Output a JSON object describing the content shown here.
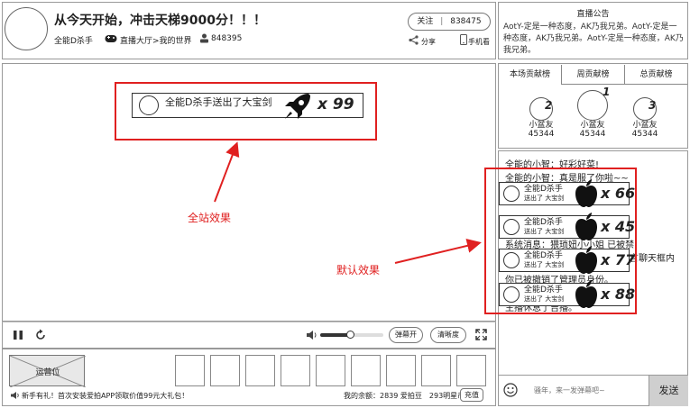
{
  "header": {
    "title": "从今天开始，冲击天梯9000分！！！",
    "streamer": "全能D杀手",
    "breadcrumb": "直播大厅>我的世界",
    "viewer_count": "848395",
    "follow_label": "关注",
    "follow_count": "838475",
    "share_label": "分享",
    "mobile_label": "手机看"
  },
  "announcement": {
    "title": "直播公告",
    "text": "AotY-定是一种态度，AK乃我兄弟。AotY-定是一种态度，AK乃我兄弟。AotY-定是一种态度，AK乃我兄弟。"
  },
  "player": {
    "site_effect": {
      "name": "全能D杀手送出了大宝剑",
      "count": "x 99"
    },
    "site_effect_label": "全站效果",
    "default_effect_label": "默认效果",
    "danmu_on_label": "弹幕开",
    "quality_label": "清晰度"
  },
  "bottom": {
    "ad_label": "运营位",
    "promo_text": "新手有礼！首次安装爱拍APP领取价值99元大礼包！",
    "balance_text": "我的余额：2839 爱拍豆　293明星币",
    "recharge_label": "充值"
  },
  "ranking": {
    "tabs": [
      "本场贡献榜",
      "周贡献榜",
      "总贡献榜"
    ],
    "items": [
      {
        "rank": "2",
        "name": "小盆友",
        "score": "45344"
      },
      {
        "rank": "1",
        "name": "小盆友",
        "score": "45344"
      },
      {
        "rank": "3",
        "name": "小盆友",
        "score": "45344"
      }
    ]
  },
  "chat": {
    "lines": [
      "全能的小智：好彩好菜!",
      "全能的小智：真是服了你啦~~",
      "系统消息：猥琐妞小小姐 已被禁",
      "言聊天框内",
      "你已被撤销了管理员身份。",
      "主播休息了吉播。"
    ],
    "gifts": [
      {
        "name": "全能D杀手",
        "action": "送出了 大宝剑",
        "count": "x 66"
      },
      {
        "name": "全能D杀手",
        "action": "送出了 大宝剑",
        "count": "x 45"
      },
      {
        "name": "全能D杀手",
        "action": "送出了 大宝剑",
        "count": "x 77"
      },
      {
        "name": "全能D杀手",
        "action": "送出了 大宝剑",
        "count": "x 88"
      }
    ],
    "input_placeholder": "骚年，来一发弹幕吧~",
    "send_label": "发送"
  },
  "colors": {
    "annotation_red": "#e02020",
    "send_bg": "#cfcfcf"
  }
}
